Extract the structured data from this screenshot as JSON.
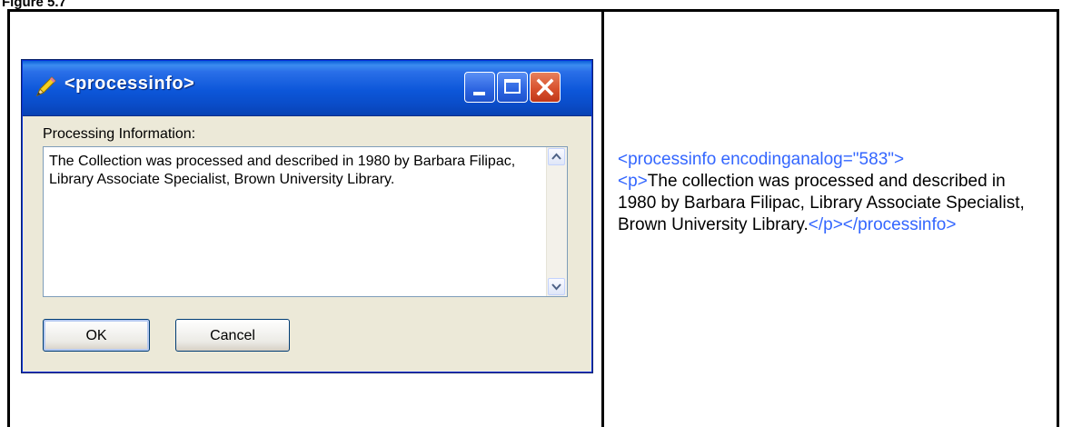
{
  "caption": "Figure 5.7",
  "dialog": {
    "title": "<processinfo>",
    "field_label": "Processing Information:",
    "text_value": "The Collection was processed and described in 1980 by Barbara Filipac, Library Associate Specialist, Brown University Library.",
    "ok_label": "OK",
    "cancel_label": "Cancel"
  },
  "xml": {
    "open_tag": "<processinfo encodinganalog=\"583\">",
    "p_open": "<p>",
    "body": "The collection was processed and described in 1980 by Barbara Filipac, Library Associate Specialist, Brown University Library.",
    "close_tags": "</p></processinfo>"
  },
  "colors": {
    "titlebar": "#0c56d9",
    "xml_tag": "#3366ff",
    "dialog_bg": "#ece9d8"
  }
}
